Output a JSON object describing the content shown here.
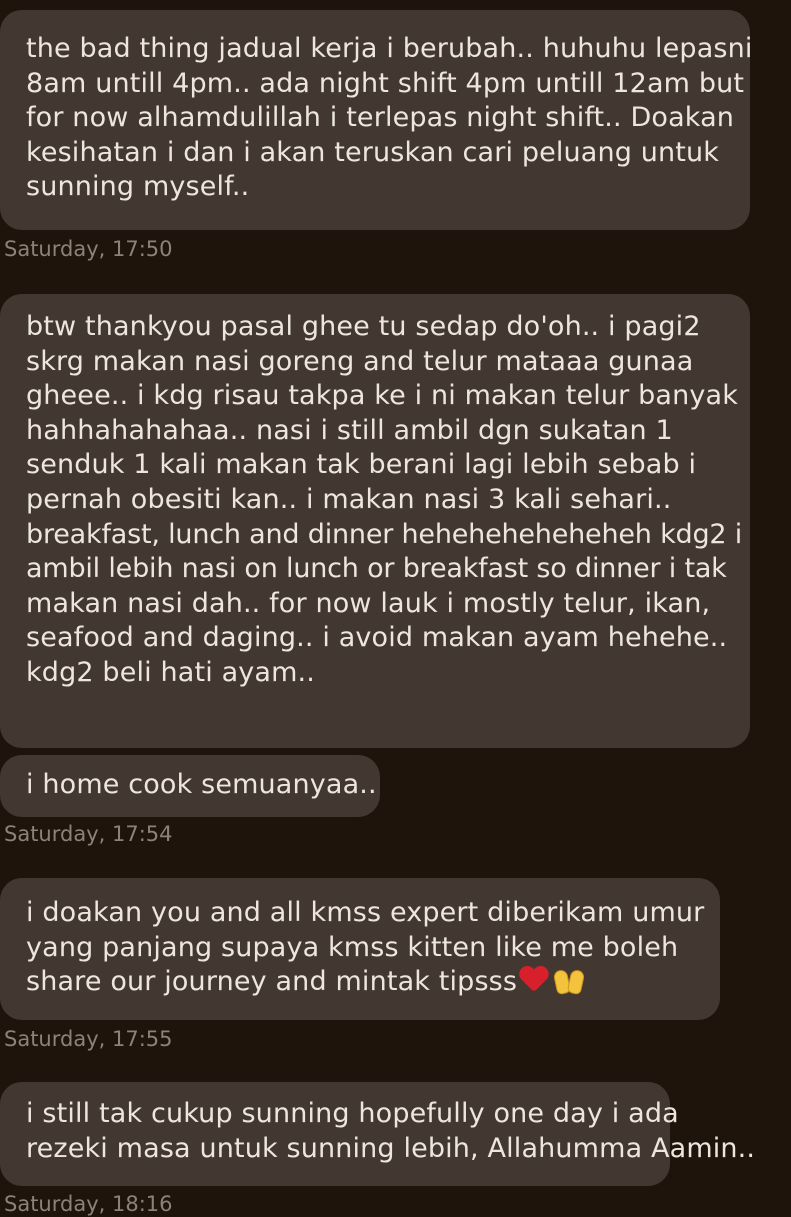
{
  "messages": [
    {
      "lines": [
        "the bad thing jadual kerja i berubah.. huhuhu lepasni",
        "8am untill 4pm.. ada night shift 4pm untill 12am but",
        "for now alhamdulillah i terlepas night shift.. Doakan",
        "kesihatan i dan i akan teruskan cari peluang untuk",
        "sunning myself.."
      ],
      "timestamp": "Saturday, 17:50"
    },
    {
      "lines": [
        "btw thankyou pasal ghee tu sedap do'oh.. i pagi2",
        "skrg makan nasi goreng and telur mataaa gunaa",
        "gheee.. i kdg risau takpa ke i ni makan telur banyak",
        "hahhahahahaa.. nasi i still ambil dgn sukatan 1",
        "senduk 1 kali makan tak berani lagi lebih sebab i",
        "pernah obesiti kan.. i makan nasi 3 kali sehari..",
        "breakfast, lunch and dinner heheheheheheheh kdg2 i",
        "ambil lebih nasi on lunch or breakfast so dinner i tak",
        "makan nasi dah.. for now lauk i mostly telur, ikan,",
        "seafood and daging.. i  avoid makan ayam hehehe..",
        "kdg2 beli hati ayam.."
      ]
    },
    {
      "lines": [
        "i home cook semuanyaa.."
      ],
      "timestamp": "Saturday, 17:54"
    },
    {
      "lines": [
        "i doakan you and all kmss expert diberikam umur",
        "yang panjang supaya kmss kitten like me boleh",
        "share our journey and mintak tipsss"
      ],
      "emoji": [
        "red-heart",
        "raising-hands"
      ],
      "timestamp": "Saturday, 17:55"
    },
    {
      "lines": [
        "i still tak cukup sunning hopefully one day i ada",
        "rezeki masa untuk sunning lebih, Allahumma Aamin.."
      ],
      "timestamp": "Saturday, 18:16"
    }
  ],
  "colors": {
    "background": "#1f140c",
    "bubble": "#433831",
    "text": "#ece6df",
    "timestamp": "#8c8279",
    "heart": "#d8202c",
    "hands": "#f4c33d"
  }
}
